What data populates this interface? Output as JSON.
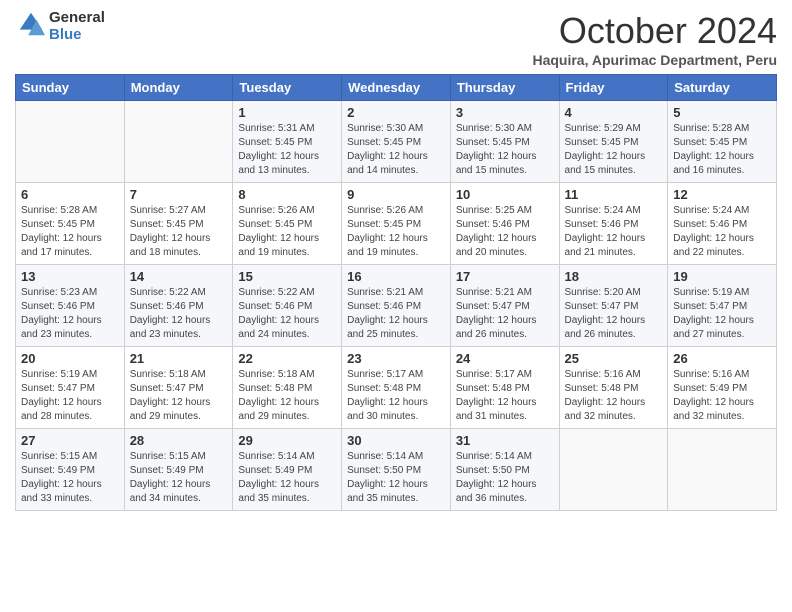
{
  "header": {
    "title": "October 2024",
    "subtitle": "Haquira, Apurimac Department, Peru"
  },
  "calendar": {
    "headers": [
      "Sunday",
      "Monday",
      "Tuesday",
      "Wednesday",
      "Thursday",
      "Friday",
      "Saturday"
    ],
    "weeks": [
      [
        {
          "day": "",
          "info": ""
        },
        {
          "day": "",
          "info": ""
        },
        {
          "day": "1",
          "info": "Sunrise: 5:31 AM\nSunset: 5:45 PM\nDaylight: 12 hours and 13 minutes."
        },
        {
          "day": "2",
          "info": "Sunrise: 5:30 AM\nSunset: 5:45 PM\nDaylight: 12 hours and 14 minutes."
        },
        {
          "day": "3",
          "info": "Sunrise: 5:30 AM\nSunset: 5:45 PM\nDaylight: 12 hours and 15 minutes."
        },
        {
          "day": "4",
          "info": "Sunrise: 5:29 AM\nSunset: 5:45 PM\nDaylight: 12 hours and 15 minutes."
        },
        {
          "day": "5",
          "info": "Sunrise: 5:28 AM\nSunset: 5:45 PM\nDaylight: 12 hours and 16 minutes."
        }
      ],
      [
        {
          "day": "6",
          "info": "Sunrise: 5:28 AM\nSunset: 5:45 PM\nDaylight: 12 hours and 17 minutes."
        },
        {
          "day": "7",
          "info": "Sunrise: 5:27 AM\nSunset: 5:45 PM\nDaylight: 12 hours and 18 minutes."
        },
        {
          "day": "8",
          "info": "Sunrise: 5:26 AM\nSunset: 5:45 PM\nDaylight: 12 hours and 19 minutes."
        },
        {
          "day": "9",
          "info": "Sunrise: 5:26 AM\nSunset: 5:45 PM\nDaylight: 12 hours and 19 minutes."
        },
        {
          "day": "10",
          "info": "Sunrise: 5:25 AM\nSunset: 5:46 PM\nDaylight: 12 hours and 20 minutes."
        },
        {
          "day": "11",
          "info": "Sunrise: 5:24 AM\nSunset: 5:46 PM\nDaylight: 12 hours and 21 minutes."
        },
        {
          "day": "12",
          "info": "Sunrise: 5:24 AM\nSunset: 5:46 PM\nDaylight: 12 hours and 22 minutes."
        }
      ],
      [
        {
          "day": "13",
          "info": "Sunrise: 5:23 AM\nSunset: 5:46 PM\nDaylight: 12 hours and 23 minutes."
        },
        {
          "day": "14",
          "info": "Sunrise: 5:22 AM\nSunset: 5:46 PM\nDaylight: 12 hours and 23 minutes."
        },
        {
          "day": "15",
          "info": "Sunrise: 5:22 AM\nSunset: 5:46 PM\nDaylight: 12 hours and 24 minutes."
        },
        {
          "day": "16",
          "info": "Sunrise: 5:21 AM\nSunset: 5:46 PM\nDaylight: 12 hours and 25 minutes."
        },
        {
          "day": "17",
          "info": "Sunrise: 5:21 AM\nSunset: 5:47 PM\nDaylight: 12 hours and 26 minutes."
        },
        {
          "day": "18",
          "info": "Sunrise: 5:20 AM\nSunset: 5:47 PM\nDaylight: 12 hours and 26 minutes."
        },
        {
          "day": "19",
          "info": "Sunrise: 5:19 AM\nSunset: 5:47 PM\nDaylight: 12 hours and 27 minutes."
        }
      ],
      [
        {
          "day": "20",
          "info": "Sunrise: 5:19 AM\nSunset: 5:47 PM\nDaylight: 12 hours and 28 minutes."
        },
        {
          "day": "21",
          "info": "Sunrise: 5:18 AM\nSunset: 5:47 PM\nDaylight: 12 hours and 29 minutes."
        },
        {
          "day": "22",
          "info": "Sunrise: 5:18 AM\nSunset: 5:48 PM\nDaylight: 12 hours and 29 minutes."
        },
        {
          "day": "23",
          "info": "Sunrise: 5:17 AM\nSunset: 5:48 PM\nDaylight: 12 hours and 30 minutes."
        },
        {
          "day": "24",
          "info": "Sunrise: 5:17 AM\nSunset: 5:48 PM\nDaylight: 12 hours and 31 minutes."
        },
        {
          "day": "25",
          "info": "Sunrise: 5:16 AM\nSunset: 5:48 PM\nDaylight: 12 hours and 32 minutes."
        },
        {
          "day": "26",
          "info": "Sunrise: 5:16 AM\nSunset: 5:49 PM\nDaylight: 12 hours and 32 minutes."
        }
      ],
      [
        {
          "day": "27",
          "info": "Sunrise: 5:15 AM\nSunset: 5:49 PM\nDaylight: 12 hours and 33 minutes."
        },
        {
          "day": "28",
          "info": "Sunrise: 5:15 AM\nSunset: 5:49 PM\nDaylight: 12 hours and 34 minutes."
        },
        {
          "day": "29",
          "info": "Sunrise: 5:14 AM\nSunset: 5:49 PM\nDaylight: 12 hours and 35 minutes."
        },
        {
          "day": "30",
          "info": "Sunrise: 5:14 AM\nSunset: 5:50 PM\nDaylight: 12 hours and 35 minutes."
        },
        {
          "day": "31",
          "info": "Sunrise: 5:14 AM\nSunset: 5:50 PM\nDaylight: 12 hours and 36 minutes."
        },
        {
          "day": "",
          "info": ""
        },
        {
          "day": "",
          "info": ""
        }
      ]
    ]
  }
}
